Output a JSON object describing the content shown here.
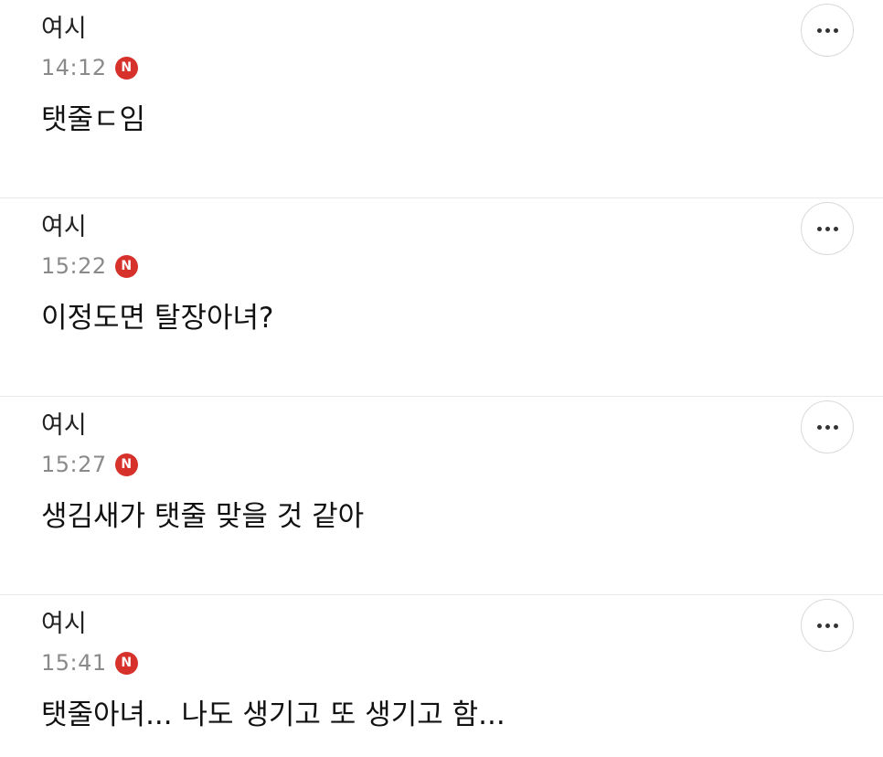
{
  "comments": [
    {
      "author": "여시",
      "time": "14:12",
      "badge": "N",
      "text": "탯줄ㄷ임",
      "more_icon": "more-horizontal-icon"
    },
    {
      "author": "여시",
      "time": "15:22",
      "badge": "N",
      "text": "이정도면 탈장아녀?",
      "more_icon": "more-horizontal-icon"
    },
    {
      "author": "여시",
      "time": "15:27",
      "badge": "N",
      "text": "생김새가 탯줄 맞을 것 같아",
      "more_icon": "more-horizontal-icon"
    },
    {
      "author": "여시",
      "time": "15:41",
      "badge": "N",
      "text": "탯줄아녀... 나도 생기고 또 생기고 함...",
      "more_icon": "more-horizontal-icon"
    }
  ],
  "colors": {
    "badge": "#d6312b",
    "time": "#8a8a8a",
    "divider": "#e8e8e8"
  }
}
